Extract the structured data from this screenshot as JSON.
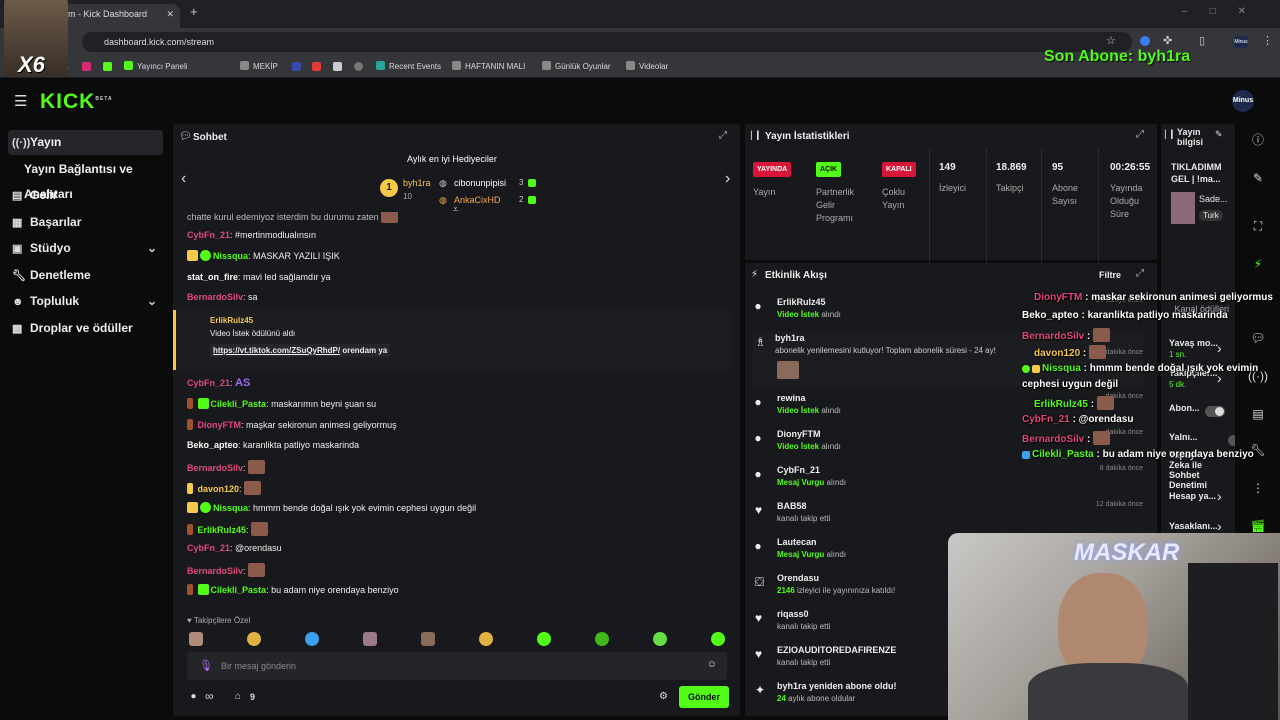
{
  "browser": {
    "tab_title": "m - Kick Dashboard",
    "url": "dashboard.kick.com/stream",
    "bookmarks": [
      "Yayıncı Paneli",
      "MEKİP",
      "Recent Events",
      "HAFTANIN MALI",
      "Günlük Oyunlar",
      "Videolar"
    ],
    "overlay_tag": "X6",
    "profile_badge": "Minus"
  },
  "overlay": {
    "son_abone": "Son Abone: byh1ra",
    "webcam_text": "MASKAR"
  },
  "app": {
    "logo": "KICK",
    "logo_beta": "BETA"
  },
  "sidebar": {
    "items": [
      {
        "label": "Yayın",
        "icon": "broadcast-icon"
      },
      {
        "label": "Yayın Bağlantısı ve Anahtarı",
        "icon": ""
      },
      {
        "label": "Gelir",
        "icon": "revenue-icon"
      },
      {
        "label": "Başarılar",
        "icon": "achievements-icon"
      },
      {
        "label": "Stüdyo",
        "icon": "studio-icon"
      },
      {
        "label": "Denetleme",
        "icon": "wrench-icon"
      },
      {
        "label": "Topluluk",
        "icon": "community-icon"
      },
      {
        "label": "Droplar ve ödüller",
        "icon": "gift-icon"
      }
    ]
  },
  "chat": {
    "title": "Sohbet",
    "gifters_title": "Aylık en iyi Hediyeciler",
    "gifters": [
      {
        "rank": "1",
        "name": "byh1ra",
        "count": "10"
      },
      {
        "rank": "",
        "name": "cibonunpipisi",
        "count": "3"
      },
      {
        "rank": "",
        "name": "AnkaCixHD",
        "count": "2"
      }
    ],
    "truncated_top": "chatte kurul edemiyoz isterdim bu durumu zaten",
    "messages": [
      {
        "user": "CybFn_21",
        "text": ": #mertinmodlualınsın",
        "color": "#e2487c"
      },
      {
        "user": "Nissqua",
        "text": ": MASKAR YAZILI IŞIK",
        "color": "#53fc18"
      },
      {
        "user": "stat_on_fire",
        "text": ": mavi led sağlamdır ya",
        "color": "#ffffff"
      },
      {
        "user": "BernardoSilv",
        "text": ": sa",
        "color": "#e2487c"
      }
    ],
    "redeem": {
      "user": "ErlikRulz45",
      "line": "Video İstek ödülünü aldı",
      "link": "https://vt.tiktok.com/ZSuQyRhdP/",
      "suffix": " orendam ya"
    },
    "messages2": [
      {
        "user": "CybFn_21",
        "text": ": ",
        "color": "#e2487c",
        "emote": "AS"
      },
      {
        "user": "Cilekli_Pasta",
        "text": ": maskarımın beyni şuan su",
        "color": "#53fc18"
      },
      {
        "user": "DionyFTM",
        "text": ": maşkar sekironun animesi geliyormuş",
        "color": "#e2487c"
      },
      {
        "user": "Beko_apteo",
        "text": ": karanlikta patliyo maskarinda",
        "color": "#ffffff"
      },
      {
        "user": "BernardoSilv",
        "text": ":",
        "color": "#e2487c"
      },
      {
        "user": "davon120",
        "text": ":",
        "color": "#f6c94a"
      },
      {
        "user": "Nissqua",
        "text": ": hmmm bende doğal ışık yok evimin cephesi uygun değil",
        "color": "#53fc18"
      },
      {
        "user": "ErlikRulz45",
        "text": ":",
        "color": "#53fc18"
      },
      {
        "user": "CybFn_21",
        "text": ": @orendasu",
        "color": "#e2487c"
      },
      {
        "user": "BernardoSilv",
        "text": ":",
        "color": "#e2487c"
      },
      {
        "user": "Cilekli_Pasta",
        "text": ": bu adam niye orendaya benziyo",
        "color": "#53fc18"
      }
    ],
    "followers_only": "Takipçilere Özel",
    "input_placeholder": "Bir mesaj gönderin",
    "infinity": "∞",
    "points": "9",
    "send_label": "Gönder"
  },
  "stats": {
    "title": "Yayın İstatistikleri",
    "tags": [
      {
        "tag": "YAYINDA",
        "label": "Yayın",
        "bg": "#d6173a"
      },
      {
        "tag": "AÇIK",
        "label": "Partnerlik Gelir Programı",
        "bg": "#53fc18"
      },
      {
        "tag": "KAPALI",
        "label": "Çoklu Yayın",
        "bg": "#d6173a"
      }
    ],
    "numbers": [
      {
        "value": "149",
        "label": "İzleyici"
      },
      {
        "value": "18.869",
        "label": "Takipçi"
      },
      {
        "value": "95",
        "label": "Abone Sayısı"
      },
      {
        "value": "00:26:55",
        "label": "Yayında Olduğu Süre"
      }
    ]
  },
  "activity": {
    "title": "Etkinlik Akışı",
    "filter": "Filtre",
    "items": [
      {
        "name": "ErlikRulz45",
        "desc_hl": "Video İstek",
        "desc": " alındı",
        "time": "27 saniye önce",
        "icon": "redeem-icon"
      },
      {
        "name": "byh1ra",
        "desc_hl": "",
        "desc": "abonelik yenilemesini kutluyor! Toplam abonelik süresi - 24 ay!",
        "time": "8 dakika önce",
        "icon": "sub-icon"
      },
      {
        "name": "rewina",
        "desc_hl": "Video İstek",
        "desc": " alındı",
        "time": "dakika önce",
        "icon": "redeem-icon"
      },
      {
        "name": "DionyFTM",
        "desc_hl": "Video İstek",
        "desc": " alındı",
        "time": "dakika önce",
        "icon": "redeem-icon"
      },
      {
        "name": "CybFn_21",
        "desc_hl": "Mesaj Vurgu",
        "desc": " alındı",
        "time": "8 dakika önce",
        "icon": "redeem-icon"
      },
      {
        "name": "BAB58",
        "desc_hl": "",
        "desc": "kanalı takip etti",
        "time": "12 dakika önce",
        "icon": "heart-icon"
      },
      {
        "name": "Lautecan",
        "desc_hl": "Mesaj Vurgu",
        "desc": " alındı",
        "time": "",
        "icon": "redeem-icon"
      },
      {
        "name": "Orendasu",
        "desc_hl": "2146",
        "desc": " izleyici ile yayınınıza katıldı!",
        "time": "",
        "icon": "raid-icon"
      },
      {
        "name": "riqass0",
        "desc_hl": "",
        "desc": "kanalı takip etti",
        "time": "",
        "icon": "heart-icon"
      },
      {
        "name": "EZIOAUDITOREDAFIRENZE",
        "desc_hl": "",
        "desc": "kanalı takip etti",
        "time": "",
        "icon": "heart-icon"
      },
      {
        "name": "byh1ra yeniden abone oldu!",
        "desc_hl": "24",
        "desc": " aylık abone oldular",
        "time": "",
        "icon": "sparkle-icon"
      }
    ]
  },
  "overlay_chat": [
    {
      "user": "DionyFTM",
      "text": " : maskar sekironun animesi geliyormus",
      "color": "#e2487c"
    },
    {
      "user": "Beko_apteo",
      "text": " : karanlikta patliyo maskarinda",
      "color": "#ffffff"
    },
    {
      "user": "BernardoSilv",
      "text": " :",
      "color": "#e2487c"
    },
    {
      "user": "davon120",
      "text": " :",
      "color": "#f6c94a"
    },
    {
      "user": "Nissqua",
      "text": " : hmmm bende doğal ışık yok evimin",
      "color": "#53fc18"
    },
    {
      "user": "",
      "text": "cephesi uygun değil",
      "color": "#ffffff"
    },
    {
      "user": "ErlikRulz45",
      "text": " :",
      "color": "#53fc18"
    },
    {
      "user": "CybFn_21",
      "text": " : @orendasu",
      "color": "#e2487c"
    },
    {
      "user": "BernardoSilv",
      "text": " :",
      "color": "#e2487c"
    },
    {
      "user": "Cilekli_Pasta",
      "text": " : bu adam niye orendaya benziyo",
      "color": "#53fc18"
    }
  ],
  "stream_info": {
    "title": "Yayın bilgisi",
    "stream_title": "TIKLADIMM GEL | !ma...",
    "category": "Sade...",
    "tag": "Turk",
    "rows": [
      {
        "label": "Kanal ödülleri",
        "value": ""
      },
      {
        "label": "Yavaş mo...",
        "value": "1 sn."
      },
      {
        "label": "Takipçiler...",
        "value": "5 dk."
      },
      {
        "label": "Abon...",
        "value": ""
      },
      {
        "label": "Yalnı...",
        "value": ""
      },
      {
        "label": "Yapay Zeka ile Sohbet Denetimi",
        "value": ""
      },
      {
        "label": "Hesap ya...",
        "value": ""
      },
      {
        "label": "Yasaklanı...",
        "value": ""
      }
    ]
  }
}
